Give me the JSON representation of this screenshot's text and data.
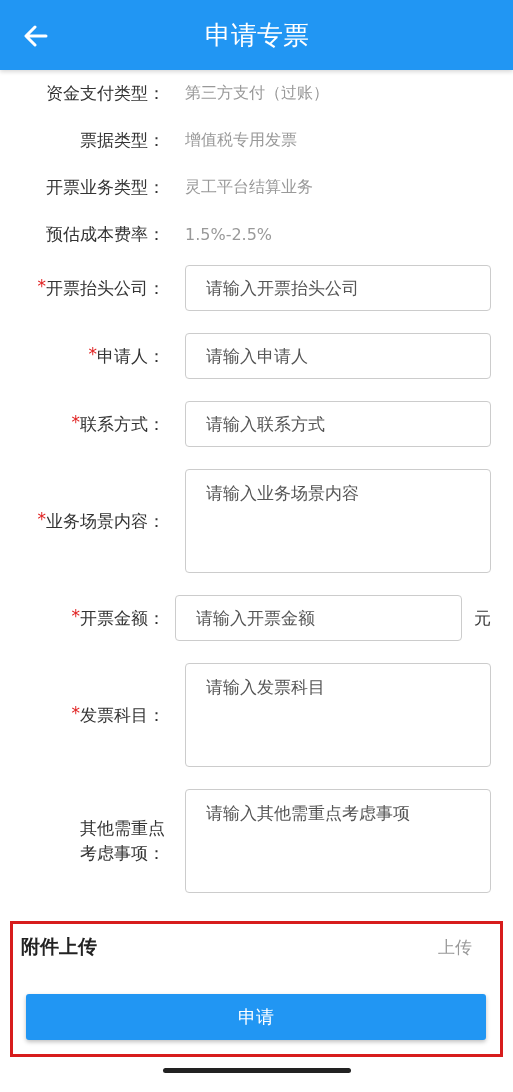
{
  "header": {
    "title": "申请专票"
  },
  "info": [
    {
      "label": "资金支付类型：",
      "value": "第三方支付（过账）"
    },
    {
      "label": "票据类型：",
      "value": "增值税专用发票"
    },
    {
      "label": "开票业务类型：",
      "value": "灵工平台结算业务"
    },
    {
      "label": "预估成本费率：",
      "value": "1.5%-2.5%"
    }
  ],
  "fields": [
    {
      "kind": "input",
      "mark": "*",
      "label": "开票抬头公司：",
      "placeholder": "请输入开票抬头公司"
    },
    {
      "kind": "input",
      "mark": "*",
      "label": "申请人：",
      "placeholder": "请输入申请人"
    },
    {
      "kind": "input",
      "mark": "*",
      "label": "联系方式：",
      "placeholder": "请输入联系方式"
    },
    {
      "kind": "textarea",
      "mark": "*",
      "label": "业务场景内容：",
      "placeholder": "请输入业务场景内容"
    },
    {
      "kind": "input_unit",
      "mark": "*",
      "label": "开票金额：",
      "placeholder": "请输入开票金额",
      "unit": "元"
    },
    {
      "kind": "textarea",
      "mark": "*",
      "label": "发票科目：",
      "placeholder": "请输入发票科目"
    },
    {
      "kind": "textarea",
      "label": [
        "其他需重点",
        "考虑事项："
      ],
      "placeholder": "请输入其他需重点考虑事项"
    }
  ],
  "attachment": {
    "title": "附件上传",
    "action": "上传"
  },
  "submit": {
    "label": "申请"
  }
}
